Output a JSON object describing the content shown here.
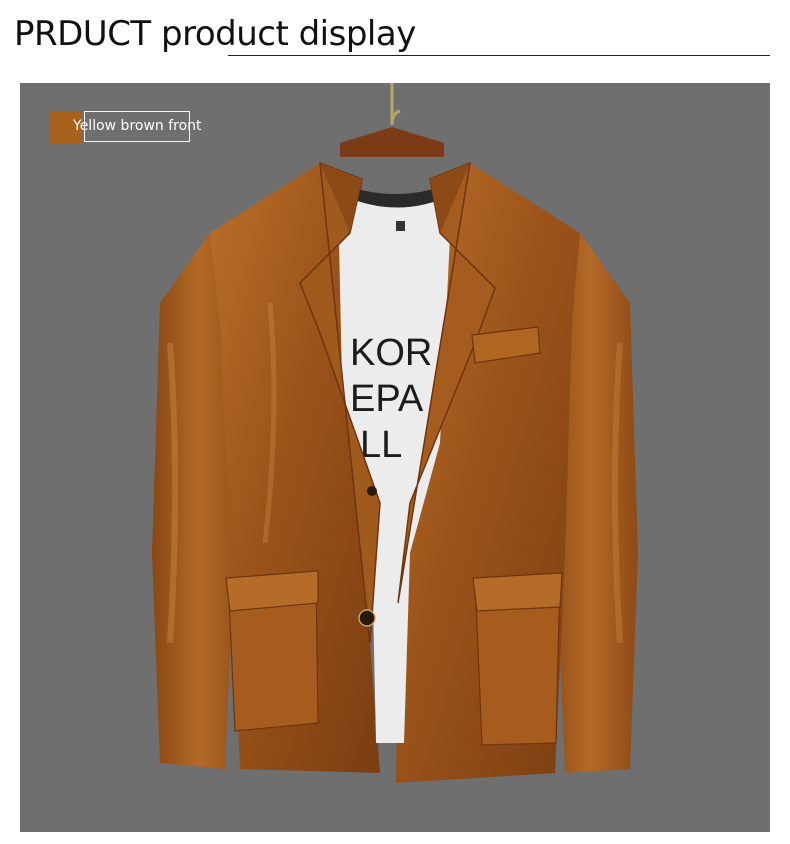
{
  "header": {
    "title": "PRDUCT product display"
  },
  "product_image": {
    "color_tag": "Yellow brown front",
    "swatch_color": "#a8621c",
    "background_color": "#6f6f6f",
    "jacket_color": "#a65a1c",
    "shirt_print_lines": [
      "KOR",
      "EPA",
      "LL"
    ]
  }
}
